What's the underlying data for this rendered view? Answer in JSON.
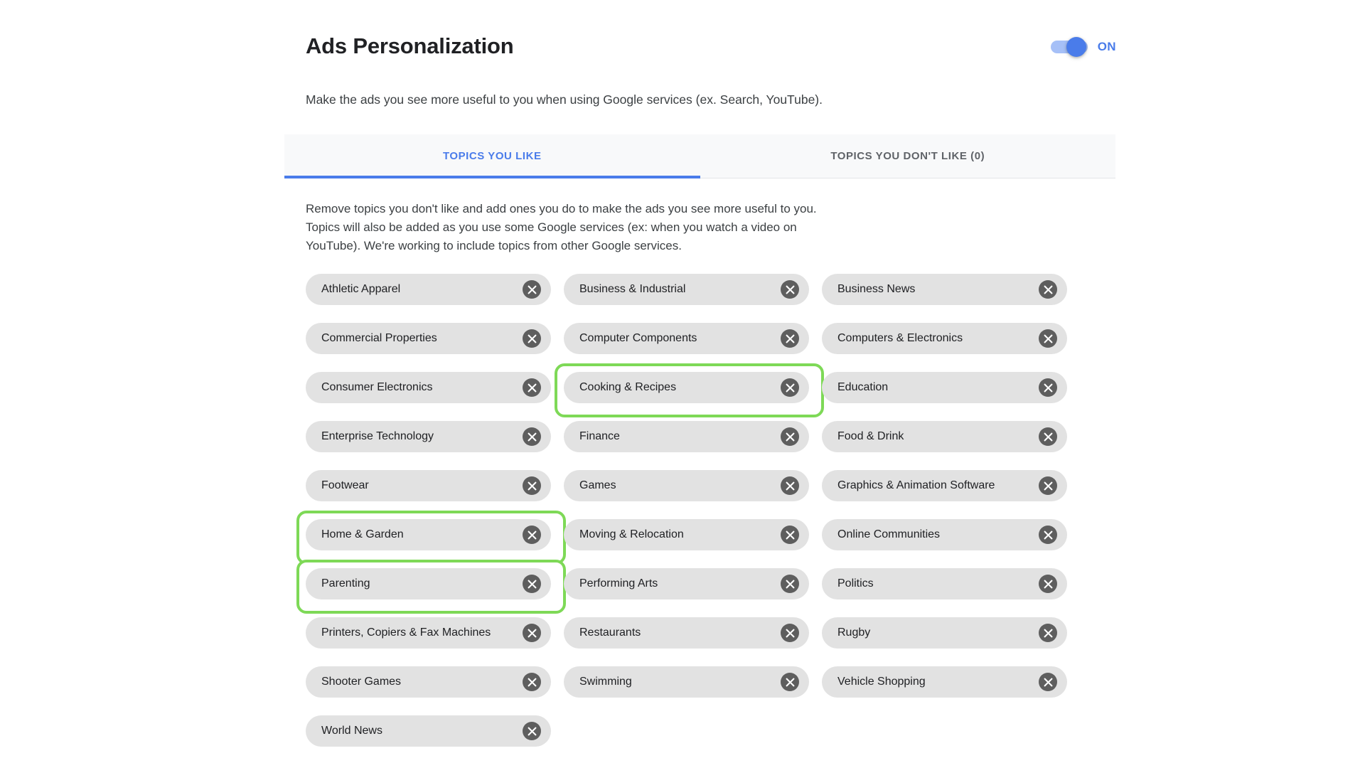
{
  "header": {
    "title": "Ads Personalization",
    "toggle": {
      "label": "ON",
      "state": "on",
      "track_color": "#a6c0f7",
      "knob_color": "#4a7cea",
      "label_color": "#4a7cea"
    }
  },
  "subtitle": "Make the ads you see more useful to you when using Google services (ex. Search, YouTube).",
  "tabs": [
    {
      "label": "TOPICS YOU LIKE",
      "active": true
    },
    {
      "label": "TOPICS YOU DON'T LIKE (0)",
      "active": false
    }
  ],
  "description": "Remove topics you don't like and add ones you do to make the ads you see more useful to you. Topics will also be added as you use some Google services (ex: when you watch a video on YouTube). We're working to include topics from other Google services.",
  "chips": [
    {
      "label": "Athletic Apparel",
      "highlighted": false,
      "remove_icon": "close-circle-icon"
    },
    {
      "label": "Business & Industrial",
      "highlighted": false,
      "remove_icon": "close-circle-icon"
    },
    {
      "label": "Business News",
      "highlighted": false,
      "remove_icon": "close-circle-icon"
    },
    {
      "label": "Commercial Properties",
      "highlighted": false,
      "remove_icon": "close-circle-icon"
    },
    {
      "label": "Computer Components",
      "highlighted": false,
      "remove_icon": "close-circle-icon"
    },
    {
      "label": "Computers & Electronics",
      "highlighted": false,
      "remove_icon": "close-circle-icon"
    },
    {
      "label": "Consumer Electronics",
      "highlighted": false,
      "remove_icon": "close-circle-icon"
    },
    {
      "label": "Cooking & Recipes",
      "highlighted": true,
      "remove_icon": "close-circle-icon"
    },
    {
      "label": "Education",
      "highlighted": false,
      "remove_icon": "close-circle-icon"
    },
    {
      "label": "Enterprise Technology",
      "highlighted": false,
      "remove_icon": "close-circle-icon"
    },
    {
      "label": "Finance",
      "highlighted": false,
      "remove_icon": "close-circle-icon"
    },
    {
      "label": "Food & Drink",
      "highlighted": false,
      "remove_icon": "close-circle-icon"
    },
    {
      "label": "Footwear",
      "highlighted": false,
      "remove_icon": "close-circle-icon"
    },
    {
      "label": "Games",
      "highlighted": false,
      "remove_icon": "close-circle-icon"
    },
    {
      "label": "Graphics & Animation Software",
      "highlighted": false,
      "remove_icon": "close-circle-icon"
    },
    {
      "label": "Home & Garden",
      "highlighted": true,
      "remove_icon": "close-circle-icon"
    },
    {
      "label": "Moving & Relocation",
      "highlighted": false,
      "remove_icon": "close-circle-icon"
    },
    {
      "label": "Online Communities",
      "highlighted": false,
      "remove_icon": "close-circle-icon"
    },
    {
      "label": "Parenting",
      "highlighted": true,
      "remove_icon": "close-circle-icon"
    },
    {
      "label": "Performing Arts",
      "highlighted": false,
      "remove_icon": "close-circle-icon"
    },
    {
      "label": "Politics",
      "highlighted": false,
      "remove_icon": "close-circle-icon"
    },
    {
      "label": "Printers, Copiers & Fax Machines",
      "highlighted": false,
      "remove_icon": "close-circle-icon"
    },
    {
      "label": "Restaurants",
      "highlighted": false,
      "remove_icon": "close-circle-icon"
    },
    {
      "label": "Rugby",
      "highlighted": false,
      "remove_icon": "close-circle-icon"
    },
    {
      "label": "Shooter Games",
      "highlighted": false,
      "remove_icon": "close-circle-icon"
    },
    {
      "label": "Swimming",
      "highlighted": false,
      "remove_icon": "close-circle-icon"
    },
    {
      "label": "Vehicle Shopping",
      "highlighted": false,
      "remove_icon": "close-circle-icon"
    },
    {
      "label": "World News",
      "highlighted": false,
      "remove_icon": "close-circle-icon"
    }
  ],
  "colors": {
    "chip_background": "#e2e2e2",
    "remove_icon_background": "#5e5e5e",
    "highlight_border": "#7ed957",
    "accent_blue": "#4a7cea",
    "tab_bar_background": "#f8f9fa",
    "text_primary": "#202124",
    "text_secondary": "#5f6368"
  }
}
